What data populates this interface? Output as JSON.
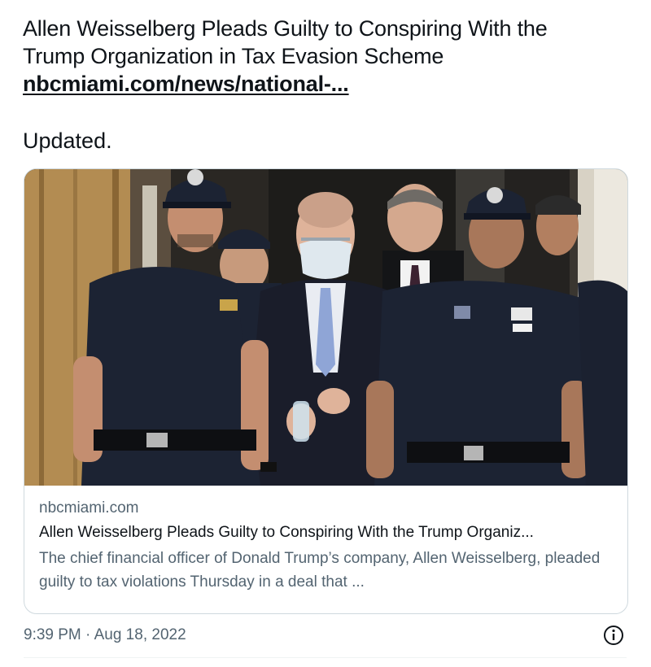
{
  "tweet": {
    "text_line_1": "Allen Weisselberg Pleads Guilty to Conspiring With the",
    "text_line_2": "Trump Organization in Tax Evasion Scheme",
    "link_text": "nbcmiami.com/news/national-...",
    "updated_text": "Updated."
  },
  "card": {
    "image_icon": "news-photo",
    "domain": "nbcmiami.com",
    "title": "Allen Weisselberg Pleads Guilty to Conspiring With the Trump Organiz...",
    "description": "The chief financial officer of Donald Trump’s company, Allen Weisselberg, pleaded guilty to tax violations Thursday in a deal that ..."
  },
  "footer": {
    "timestamp": "9:39 PM · Aug 18, 2022",
    "info_icon": "info-icon"
  },
  "colors": {
    "text_primary": "#0f1419",
    "text_secondary": "#536471",
    "border": "#cfd9de",
    "uniform_navy": "#1c2333"
  }
}
